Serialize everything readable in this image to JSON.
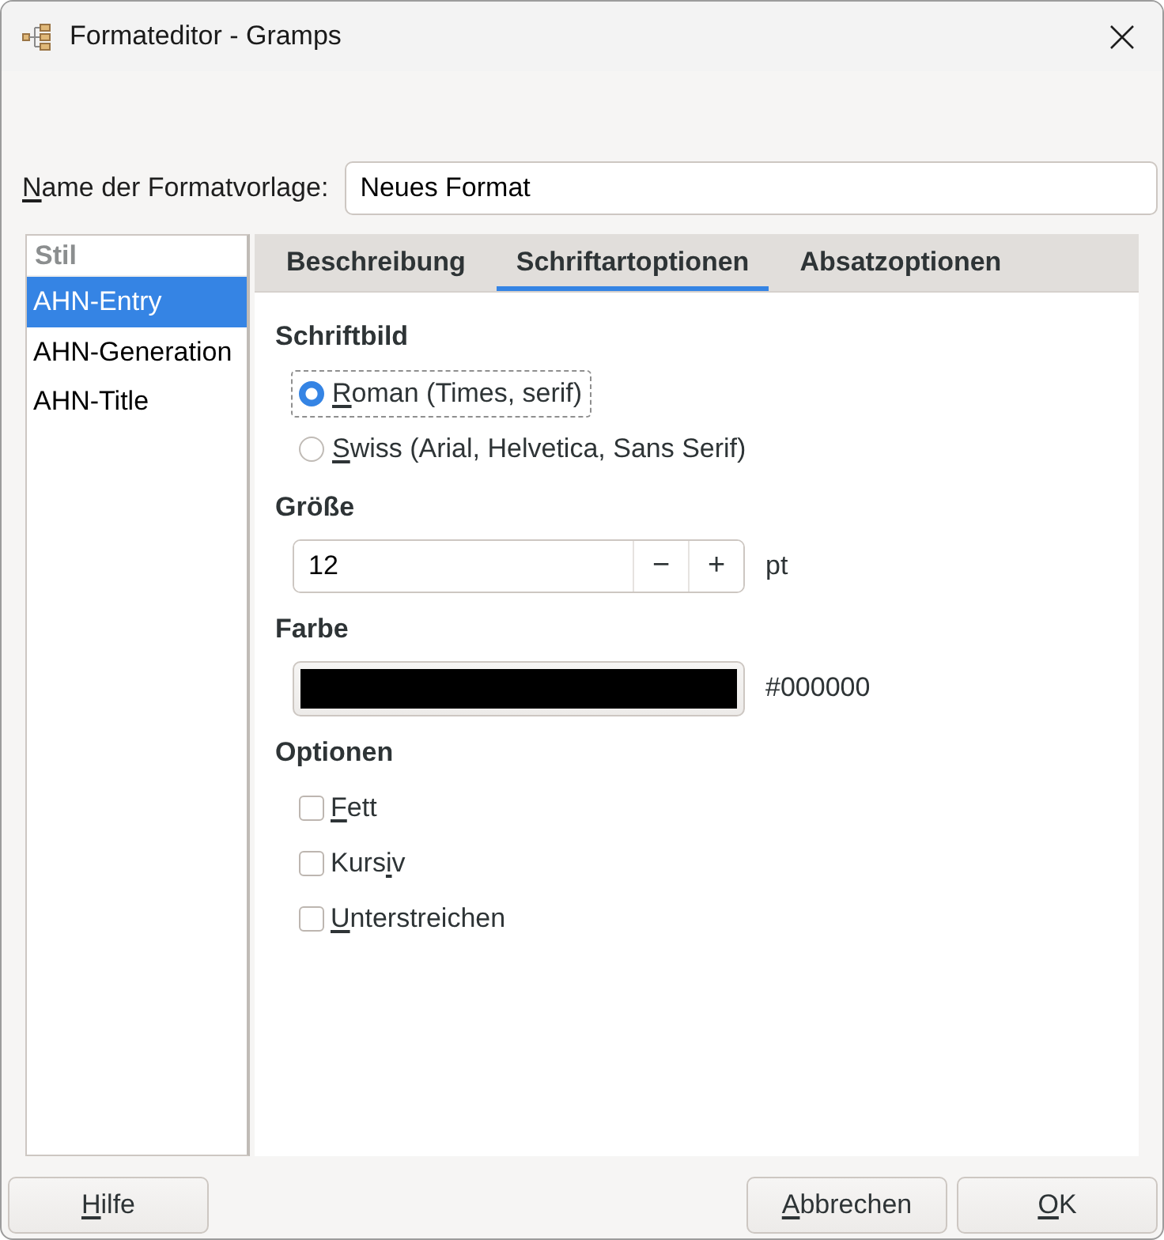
{
  "window": {
    "title": "Formateditor - Gramps"
  },
  "style_name": {
    "label": {
      "key": "N",
      "post": "ame der Formatvorlage:"
    },
    "value": "Neues Format"
  },
  "style_list": {
    "header": "Stil",
    "items": [
      {
        "label": "AHN-Entry",
        "selected": true
      },
      {
        "label": "AHN-Generation",
        "selected": false
      },
      {
        "label": "AHN-Title",
        "selected": false
      }
    ]
  },
  "tabs": [
    {
      "label": "Beschreibung",
      "selected": false
    },
    {
      "label": "Schriftartoptionen",
      "selected": true
    },
    {
      "label": "Absatzoptionen",
      "selected": false
    }
  ],
  "font_options": {
    "typeface": {
      "heading": "Schriftbild",
      "options": [
        {
          "label": {
            "key": "R",
            "post": "oman (Times, serif)"
          },
          "selected": true,
          "focused": true
        },
        {
          "label": {
            "key": "S",
            "post": "wiss (Arial, Helvetica, Sans Serif)"
          },
          "selected": false,
          "focused": false
        }
      ]
    },
    "size": {
      "heading": "Größe",
      "value": "12",
      "decrement": "−",
      "increment": "+",
      "unit": "pt"
    },
    "color": {
      "heading": "Farbe",
      "color": "#000000",
      "value": "#000000"
    },
    "options": {
      "heading": "Optionen",
      "items": [
        {
          "label": {
            "key": "F",
            "post": "ett"
          },
          "checked": false
        },
        {
          "label": {
            "pre": "Kurs",
            "key": "i",
            "post": "v"
          },
          "checked": false
        },
        {
          "label": {
            "key": "U",
            "post": "nterstreichen"
          },
          "checked": false
        }
      ]
    }
  },
  "footer": {
    "start": [
      {
        "label": {
          "key": "H",
          "post": "ilfe"
        }
      }
    ],
    "end": [
      {
        "label": {
          "key": "A",
          "post": "bbrechen"
        }
      },
      {
        "label": {
          "key": "O",
          "post": "K"
        }
      }
    ]
  }
}
